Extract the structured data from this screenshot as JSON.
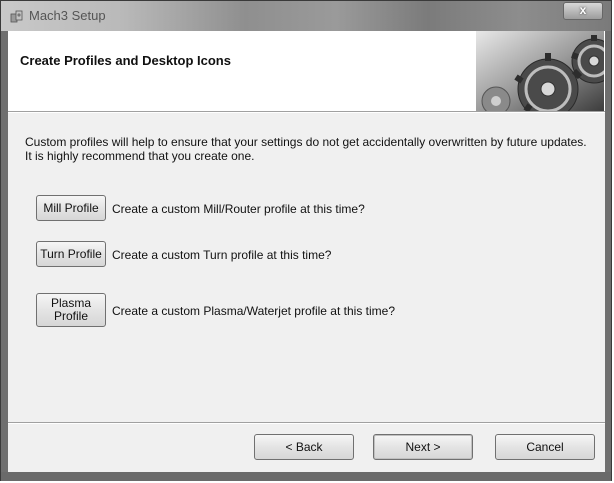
{
  "window": {
    "title": "Mach3 Setup",
    "close_glyph": "x"
  },
  "header": {
    "title": "Create Profiles and Desktop Icons",
    "graphic_icon": "gears-icon"
  },
  "intro_text": "Custom profiles will help to ensure that your settings do not get accidentally overwritten by future updates.  It is highly recommend that you create one.",
  "profiles": [
    {
      "button_label": "Mill Profile",
      "description": "Create a custom Mill/Router profile at this time?"
    },
    {
      "button_label": "Turn Profile",
      "description": "Create a custom Turn profile at this time?"
    },
    {
      "button_label": "Plasma\nProfile",
      "description": "Create a custom Plasma/Waterjet profile at this time?"
    }
  ],
  "nav": {
    "back_label": "< Back",
    "next_label": "Next >",
    "cancel_label": "Cancel"
  }
}
